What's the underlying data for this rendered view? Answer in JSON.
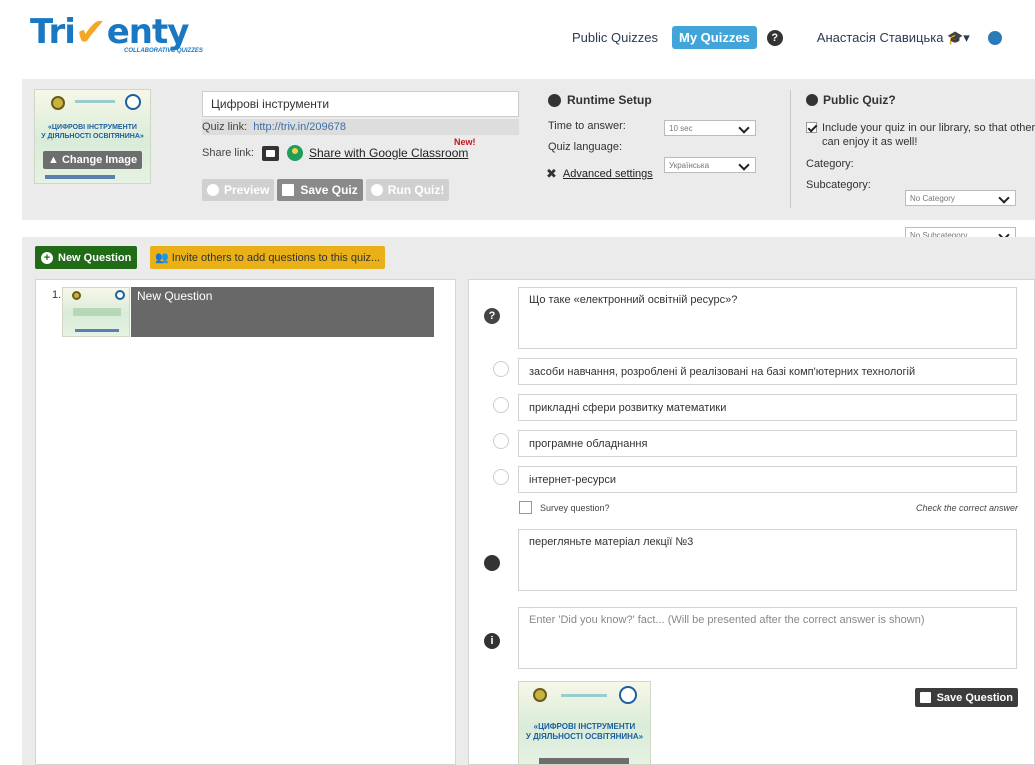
{
  "brand": {
    "logo_left": "Tri",
    "logo_v": "✔",
    "logo_right": "enty",
    "tagline": "COLLABORATIVE QUIZZES"
  },
  "nav": {
    "public_quizzes": "Public Quizzes",
    "my_quizzes": "My Quizzes",
    "help": "?",
    "user_name": "Анастасія Ставицька",
    "user_icons": "▾"
  },
  "quiz": {
    "thumb_title_line1": "«ЦИФРОВІ ІНСТРУМЕНТИ",
    "thumb_title_line2": "У ДІЯЛЬНОСТІ ОСВІТЯНИНА»",
    "change_image": "Change Image",
    "name": "Цифрові інструменти",
    "link_label": "Quiz link:",
    "link_url": "http://triv.in/209678",
    "share_label": "Share link:",
    "share_google": "Share with Google Classroom",
    "new_badge": "New!",
    "preview": "Preview",
    "save": "Save Quiz",
    "run": "Run Quiz!"
  },
  "runtime": {
    "title": "Runtime Setup",
    "time_label": "Time to answer:",
    "time_value": "10 sec",
    "lang_label": "Quiz language:",
    "lang_value": "Українська",
    "advanced": "Advanced settings"
  },
  "public": {
    "title": "Public Quiz?",
    "include_line1": "Include your quiz in our library, so that others",
    "include_line2": "can enjoy it as well!",
    "category_label": "Category:",
    "category_value": "No Category",
    "subcategory_label": "Subcategory:",
    "subcategory_value": "No Subcategory"
  },
  "toolbar": {
    "new_question": "New Question",
    "invite": "Invite others to add questions to this quiz..."
  },
  "list": {
    "items": [
      {
        "num": "1.",
        "title": "New Question"
      }
    ]
  },
  "editor": {
    "question_icon": "?",
    "question_text": "Що таке «електронний освітній ресурс»?",
    "answers": [
      "засоби навчання, розроблені й реалізовані на базі комп'ютерних технологій",
      "прикладні сфери розвитку математики",
      "програмне обладнання",
      "інтернет-ресурси"
    ],
    "survey_label": "Survey question?",
    "check_hint": "Check the correct answer",
    "hint_text": "перегляньте матеріал лекції №3",
    "didyouknow_placeholder": "Enter 'Did you know?' fact... (Will be presented after the correct answer is shown)",
    "info_icon": "i",
    "save_question": "Save Question"
  }
}
